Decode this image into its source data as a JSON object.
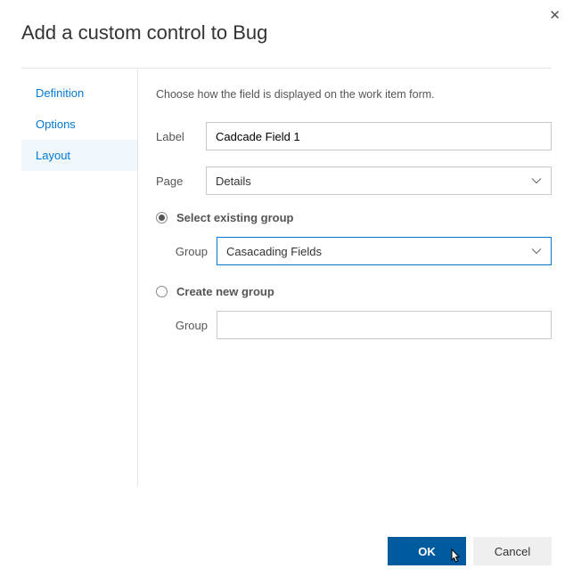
{
  "dialog": {
    "title": "Add a custom control to Bug"
  },
  "sidebar": {
    "items": [
      {
        "label": "Definition",
        "selected": false
      },
      {
        "label": "Options",
        "selected": false
      },
      {
        "label": "Layout",
        "selected": true
      }
    ]
  },
  "main": {
    "intro": "Choose how the field is displayed on the work item form.",
    "fields": {
      "label": {
        "label": "Label",
        "value": "Cadcade Field 1"
      },
      "page": {
        "label": "Page",
        "value": "Details"
      }
    },
    "group_choice": {
      "existing": {
        "radio_label": "Select existing group",
        "checked": true,
        "field_label": "Group",
        "value": "Casacading Fields"
      },
      "new": {
        "radio_label": "Create new group",
        "checked": false,
        "field_label": "Group",
        "value": ""
      }
    }
  },
  "footer": {
    "ok": "OK",
    "cancel": "Cancel"
  }
}
